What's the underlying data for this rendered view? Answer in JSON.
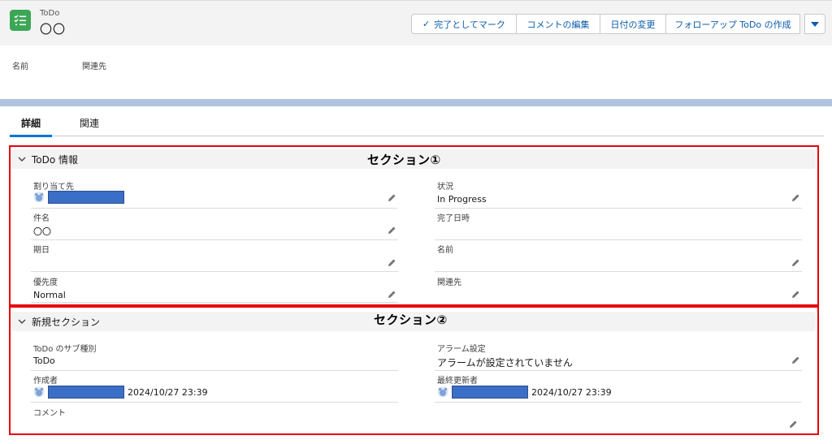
{
  "header": {
    "object_label": "ToDo",
    "record_title": "〇〇",
    "buttons": {
      "mark_complete": "完了としてマーク",
      "edit_comment": "コメントの編集",
      "change_date": "日付の変更",
      "create_followup": "フォローアップ ToDo の作成"
    }
  },
  "highlights": {
    "name_label": "名前",
    "related_label": "関連先"
  },
  "tabs": {
    "details": "詳細",
    "related": "関連"
  },
  "section1": {
    "title": "ToDo 情報",
    "annotation": "セクション①",
    "fields": {
      "assigned_label": "割り当て先",
      "status_label": "状況",
      "status_value": "In Progress",
      "subject_label": "件名",
      "subject_value": "〇〇",
      "completed_label": "完了日時",
      "due_label": "期日",
      "name_label": "名前",
      "priority_label": "優先度",
      "priority_value": "Normal",
      "related_label": "関連先"
    }
  },
  "section2": {
    "title": "新規セクション",
    "annotation": "セクション②",
    "fields": {
      "subtype_label": "ToDo のサブ種別",
      "subtype_value": "ToDo",
      "alarm_label": "アラーム設定",
      "alarm_value": "アラームが設定されていません",
      "created_label": "作成者",
      "created_date": "2024/10/27 23:39",
      "modified_label": "最終更新者",
      "modified_date": "2024/10/27 23:39",
      "comment_label": "コメント"
    }
  },
  "colors": {
    "brand": "#0176d3",
    "app_icon": "#3ba755",
    "annotation_box": "#e8000a",
    "redaction": "#3b6ec6"
  }
}
